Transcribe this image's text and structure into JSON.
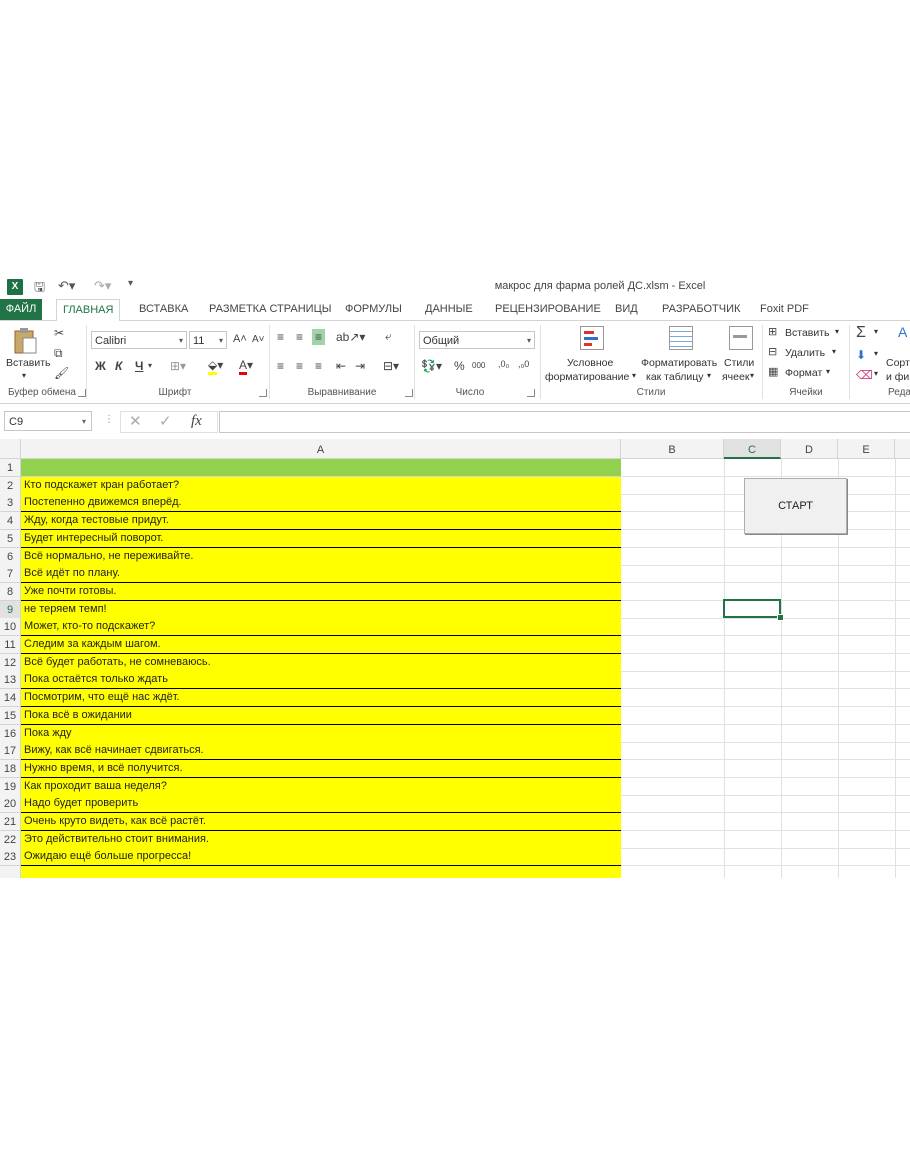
{
  "window": {
    "title": "макрос для фарма ролей ДС.xlsm - Excel"
  },
  "tabs": [
    "ФАЙЛ",
    "ГЛАВНАЯ",
    "ВСТАВКА",
    "РАЗМЕТКА СТРАНИЦЫ",
    "ФОРМУЛЫ",
    "ДАННЫЕ",
    "РЕЦЕНЗИРОВАНИЕ",
    "ВИД",
    "РАЗРАБОТЧИК",
    "Foxit PDF"
  ],
  "ribbon": {
    "clipboard": {
      "paste": "Вставить",
      "label": "Буфер обмена"
    },
    "font": {
      "name": "Calibri",
      "size": "11",
      "bold": "Ж",
      "italic": "К",
      "underline": "Ч",
      "label": "Шрифт"
    },
    "alignment": {
      "label": "Выравнивание"
    },
    "number": {
      "format": "Общий",
      "label": "Число"
    },
    "styles": {
      "cond_line1": "Условное",
      "cond_line2": "форматирование",
      "table_line1": "Форматировать",
      "table_line2": "как таблицу",
      "cell_line1": "Стили",
      "cell_line2": "ячеек",
      "label": "Стили"
    },
    "cells": {
      "insert": "Вставить",
      "delete": "Удалить",
      "format": "Формат",
      "label": "Ячейки"
    },
    "editing": {
      "sort_line1": "Сорт",
      "sort_line2": "и фи",
      "label": "Реда"
    }
  },
  "formula_bar": {
    "name_box": "C9",
    "fx": "fx",
    "value": ""
  },
  "columns": [
    "A",
    "B",
    "C",
    "D",
    "E"
  ],
  "selected_column": "C",
  "selected_row": "9",
  "rows": [
    {
      "n": "1",
      "a": ""
    },
    {
      "n": "2",
      "a": "Кто подскажет кран работает?"
    },
    {
      "n": "3",
      "a": "Постепенно движемся вперёд."
    },
    {
      "n": "4",
      "a": "Жду, когда тестовые придут."
    },
    {
      "n": "5",
      "a": "Будет интересный поворот."
    },
    {
      "n": "6",
      "a": "Всё нормально, не переживайте."
    },
    {
      "n": "7",
      "a": "Всё идёт по плану."
    },
    {
      "n": "8",
      "a": "Уже почти готовы."
    },
    {
      "n": "9",
      "a": "не теряем темп!"
    },
    {
      "n": "10",
      "a": "Может, кто-то подскажет?"
    },
    {
      "n": "11",
      "a": "Следим за каждым шагом."
    },
    {
      "n": "12",
      "a": "Всё будет работать, не сомневаюсь."
    },
    {
      "n": "13",
      "a": "Пока остаётся только ждать"
    },
    {
      "n": "14",
      "a": "Посмотрим, что ещё нас ждёт."
    },
    {
      "n": "15",
      "a": "Пока всё в ожидании"
    },
    {
      "n": "16",
      "a": "Пока жду"
    },
    {
      "n": "17",
      "a": "Вижу, как всё начинает сдвигаться."
    },
    {
      "n": "18",
      "a": "Нужно время, и всё получится."
    },
    {
      "n": "19",
      "a": "Как проходит ваша неделя?"
    },
    {
      "n": "20",
      "a": "Надо будет проверить"
    },
    {
      "n": "21",
      "a": "Очень круто видеть, как всё растёт."
    },
    {
      "n": "22",
      "a": "Это действительно стоит внимания."
    },
    {
      "n": "23",
      "a": "Ожидаю ещё больше прогресса!"
    }
  ],
  "macro_button": {
    "label": "СТАРТ"
  }
}
